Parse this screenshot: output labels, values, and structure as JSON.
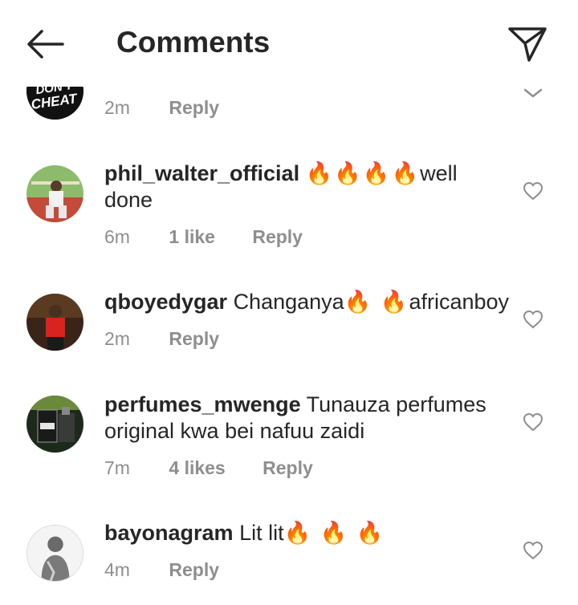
{
  "header": {
    "title": "Comments",
    "back_icon": "arrow-left-icon",
    "send_icon": "paper-plane-icon"
  },
  "partial_comment": {
    "avatar_text": "DON'T CHEAT",
    "time": "2m",
    "reply_label": "Reply"
  },
  "comments": [
    {
      "username": "phil_walter_official",
      "text": "well done",
      "fires": "🔥🔥🔥🔥",
      "text_after_fires": true,
      "time": "6m",
      "likes": "1 like",
      "reply_label": "Reply"
    },
    {
      "username": "qboyedygar",
      "text_before": "Changanya",
      "fires": "🔥 🔥",
      "text_after": "africanboy",
      "time": "2m",
      "reply_label": "Reply"
    },
    {
      "username": "perfumes_mwenge",
      "text": "Tunauza perfumes original kwa bei nafuu zaidi",
      "time": "7m",
      "likes": "4 likes",
      "reply_label": "Reply"
    },
    {
      "username": "bayonagram",
      "text": "Lit lit",
      "fires": "🔥 🔥 🔥",
      "time": "4m",
      "reply_label": "Reply"
    }
  ],
  "colors": {
    "text": "#262626",
    "secondary": "#8e8e8e",
    "background": "#ffffff"
  }
}
